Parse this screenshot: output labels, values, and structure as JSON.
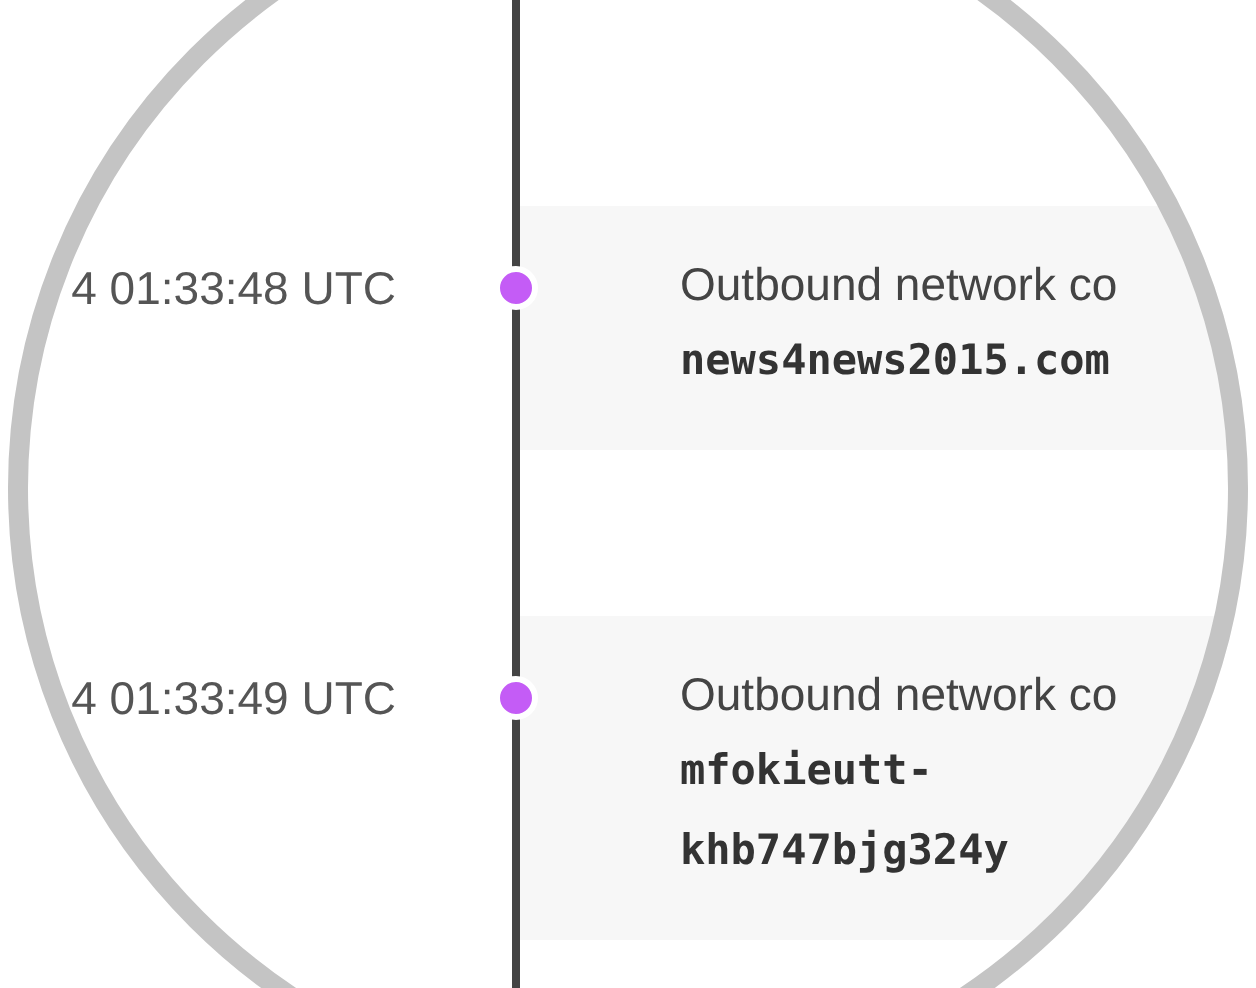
{
  "events": [
    {
      "time": "4 01:33:48 UTC",
      "title": "Outbound network co",
      "detail": "news4news2015.com",
      "color": "#c45cf6"
    },
    {
      "time": "4 01:33:49 UTC",
      "title": "Outbound network co",
      "detail": "mfokieutt-khb747bjg324y",
      "color": "#c45cf6"
    }
  ]
}
